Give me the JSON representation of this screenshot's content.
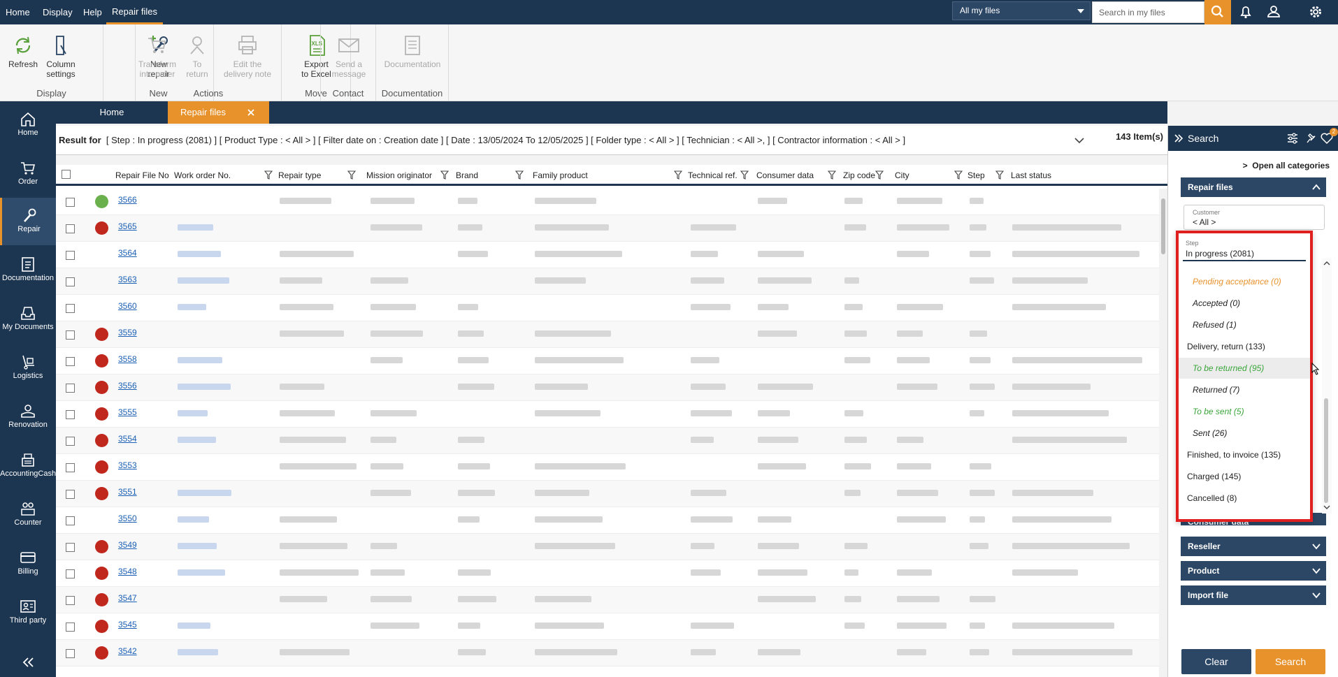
{
  "menu": {
    "items": [
      "Home",
      "Display",
      "Help",
      "Repair files"
    ],
    "scope_select": "All my files",
    "search_placeholder": "Search in my files"
  },
  "ribbon": {
    "groups": [
      {
        "label": "Display",
        "buttons": [
          {
            "l1": "Refresh",
            "l2": ""
          },
          {
            "l1": "Column",
            "l2": "settings"
          }
        ]
      },
      {
        "label": "New",
        "buttons": [
          {
            "l1": "New",
            "l2": "repair"
          }
        ]
      },
      {
        "label": "Actions",
        "buttons": [
          {
            "l1": "Transform",
            "l2": "into order"
          },
          {
            "l1": "To",
            "l2": "return"
          },
          {
            "l1": "Edit the",
            "l2": "delivery note"
          }
        ]
      },
      {
        "label": "Move",
        "buttons": [
          {
            "l1": "Export",
            "l2": "to Excel"
          }
        ]
      },
      {
        "label": "Contact",
        "buttons": [
          {
            "l1": "Send a",
            "l2": "message"
          }
        ]
      },
      {
        "label": "Documentation",
        "buttons": [
          {
            "l1": "Documentation",
            "l2": ""
          }
        ]
      }
    ]
  },
  "nav": [
    "Home",
    "Order",
    "Repair",
    "Documentation",
    "My Documents",
    "Logistics",
    "Renovation",
    "AccountingCash",
    "Counter",
    "Billing",
    "Third party"
  ],
  "tabs": {
    "home": "Home",
    "active": "Repair files"
  },
  "filter": {
    "prefix": "Result for",
    "text": "[ Step : In progress (2081) ]  [ Product Type : < All > ]  [ Filter date on : Creation date ]  [ Date : 13/05/2024 To 12/05/2025 ]  [ Folder type : < All > ]  [ Technician : < All >,  ]  [ Contractor information : < All > ]",
    "count": "143 Item(s)"
  },
  "columns": [
    "Repair File No",
    "Work order No.",
    "Repair type",
    "Mission originator",
    "Brand",
    "Family product",
    "Technical ref.",
    "Consumer data",
    "Zip code",
    "City",
    "Step",
    "Last status"
  ],
  "rows": [
    {
      "no": "3566",
      "status": "green"
    },
    {
      "no": "3565",
      "status": "red"
    },
    {
      "no": "3564",
      "status": "none"
    },
    {
      "no": "3563",
      "status": "none"
    },
    {
      "no": "3560",
      "status": "none"
    },
    {
      "no": "3559",
      "status": "red"
    },
    {
      "no": "3558",
      "status": "red"
    },
    {
      "no": "3556",
      "status": "red"
    },
    {
      "no": "3555",
      "status": "red"
    },
    {
      "no": "3554",
      "status": "red"
    },
    {
      "no": "3553",
      "status": "red"
    },
    {
      "no": "3551",
      "status": "red"
    },
    {
      "no": "3550",
      "status": "none"
    },
    {
      "no": "3549",
      "status": "red"
    },
    {
      "no": "3548",
      "status": "red"
    },
    {
      "no": "3547",
      "status": "red"
    },
    {
      "no": "3545",
      "status": "red"
    },
    {
      "no": "3542",
      "status": "red"
    }
  ],
  "panel": {
    "title": "Search",
    "badge": "2",
    "open_all": "Open all categories",
    "section_repair": "Repair files",
    "customer_label": "Customer",
    "customer_value": "< All >",
    "sections": [
      "Consumer data",
      "Reseller",
      "Product",
      "Import file"
    ],
    "clear": "Clear",
    "search": "Search"
  },
  "step_dropdown": {
    "label": "Step",
    "value": "In progress (2081)",
    "options": [
      {
        "text": "Pending acceptance (0)",
        "level": "sub",
        "color": "#e8922c"
      },
      {
        "text": "Accepted (0)",
        "level": "sub",
        "color": "#222222"
      },
      {
        "text": "Refused (1)",
        "level": "sub",
        "color": "#222222"
      },
      {
        "text": "Delivery, return (133)",
        "level": "top",
        "color": "#222222"
      },
      {
        "text": "To be returned (95)",
        "level": "sub",
        "color": "#3aa53a",
        "hover": true
      },
      {
        "text": "Returned (7)",
        "level": "sub",
        "color": "#222222"
      },
      {
        "text": "To be sent (5)",
        "level": "sub",
        "color": "#3aa53a"
      },
      {
        "text": "Sent (26)",
        "level": "sub",
        "color": "#222222"
      },
      {
        "text": "Finished, to invoice (135)",
        "level": "top",
        "color": "#222222"
      },
      {
        "text": "Charged (145)",
        "level": "top",
        "color": "#222222"
      },
      {
        "text": "Cancelled (8)",
        "level": "top",
        "color": "#222222"
      }
    ]
  },
  "colors": {
    "brand": "#1c3550",
    "accent": "#e8922c",
    "status_red": "#c0281e",
    "status_green": "#6ab04c",
    "highlight": "#e02020"
  }
}
